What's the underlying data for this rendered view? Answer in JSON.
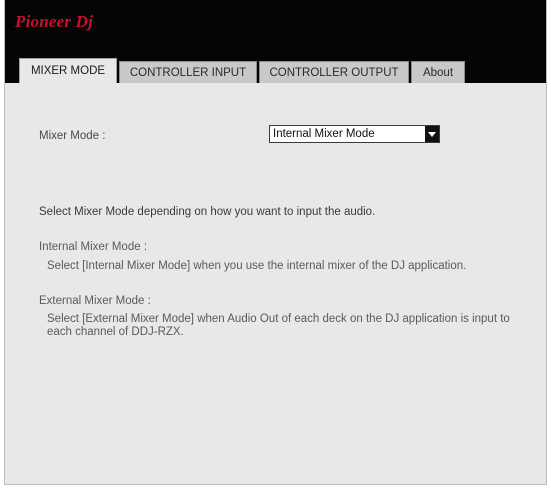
{
  "brand": {
    "logo_text": "Pioneer Dj",
    "logo_color": "#c8102e"
  },
  "tabs": [
    {
      "label": "MIXER MODE",
      "active": true
    },
    {
      "label": "CONTROLLER INPUT",
      "active": false
    },
    {
      "label": "CONTROLLER OUTPUT",
      "active": false
    },
    {
      "label": "About",
      "active": false
    }
  ],
  "mixer": {
    "label": "Mixer Mode :",
    "selected": "Internal Mixer Mode"
  },
  "help": {
    "intro": "Select Mixer Mode depending on how you want to input the audio.",
    "internal_heading": "Internal Mixer Mode :",
    "internal_desc": "Select [Internal Mixer Mode] when you use the internal mixer of the DJ application.",
    "external_heading": "External Mixer Mode :",
    "external_desc": "Select [External Mixer Mode] when Audio Out of each deck on the DJ application is input to each channel of DDJ-RZX."
  }
}
